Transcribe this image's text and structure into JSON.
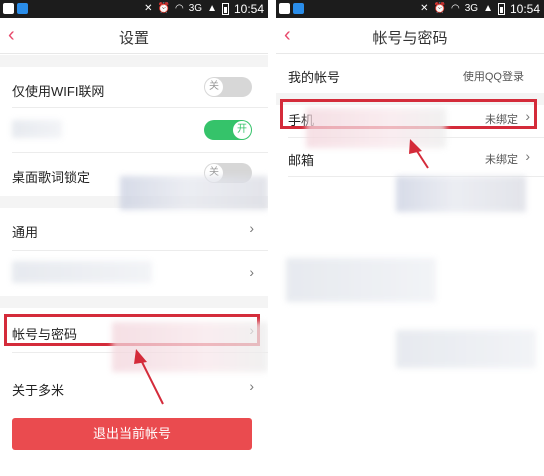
{
  "status_bar": {
    "time": "10:54",
    "network": "3G"
  },
  "left_screen": {
    "title": "设置",
    "rows": {
      "wifi_only": {
        "label": "仅使用WIFI联网",
        "toggle": "关",
        "state": "off"
      },
      "blurred_toggle_row": {
        "toggle": "开",
        "state": "on"
      },
      "lyric_lock": {
        "label": "桌面歌词锁定",
        "toggle": "关",
        "state": "off"
      },
      "general": {
        "label": "通用"
      },
      "account_password": {
        "label": "帐号与密码"
      },
      "about": {
        "label": "关于多米"
      }
    },
    "logout_label": "退出当前帐号"
  },
  "right_screen": {
    "title": "帐号与密码",
    "rows": {
      "my_account": {
        "label": "我的帐号",
        "value": "使用QQ登录"
      },
      "phone": {
        "label": "手机",
        "value": "未绑定"
      },
      "email": {
        "label": "邮箱",
        "value": "未绑定"
      }
    }
  },
  "colors": {
    "accent": "#e84a6c",
    "highlight": "#d42b3a",
    "toggle_on": "#35c36a",
    "logout": "#ea4b4f"
  }
}
